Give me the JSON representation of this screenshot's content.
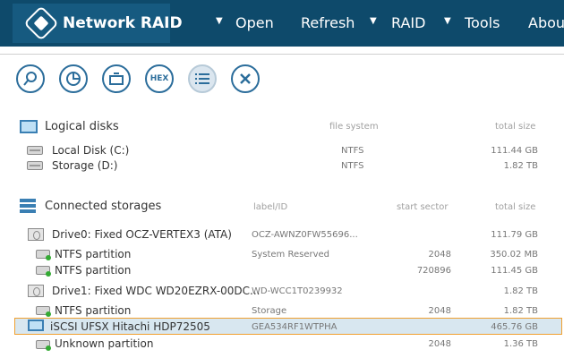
{
  "app": {
    "title": "Network RAID",
    "menu": [
      "Open",
      "Refresh",
      "RAID",
      "Tools",
      "About"
    ],
    "accent": "#0e4a6b"
  },
  "toolbar": {
    "buttons": [
      {
        "name": "search",
        "icon": "magnifier-icon"
      },
      {
        "name": "scan",
        "icon": "pie-chart-icon"
      },
      {
        "name": "image",
        "icon": "disk-image-icon"
      },
      {
        "name": "hex",
        "label": "HEX"
      },
      {
        "name": "list",
        "icon": "list-icon"
      },
      {
        "name": "close",
        "icon": "close-icon"
      }
    ]
  },
  "logical": {
    "title": "Logical disks",
    "col_fs": "file system",
    "col_size": "total size",
    "rows": [
      {
        "name": "Local Disk (C:)",
        "fs": "NTFS",
        "size": "111.44 GB"
      },
      {
        "name": "Storage (D:)",
        "fs": "NTFS",
        "size": "1.82 TB"
      }
    ]
  },
  "storages": {
    "title": "Connected storages",
    "col_label": "label/ID",
    "col_start": "start sector",
    "col_size": "total size",
    "rows": [
      {
        "name": "Drive0: Fixed OCZ-VERTEX3 (ATA)",
        "label": "OCZ-AWNZ0FW55696...",
        "start": "",
        "size": "111.79 GB"
      },
      {
        "name": "NTFS partition",
        "label": "System Reserved",
        "start": "2048",
        "size": "350.02 MB"
      },
      {
        "name": "NTFS partition",
        "label": "",
        "start": "720896",
        "size": "111.45 GB"
      },
      {
        "name": "Drive1: Fixed WDC WD20EZRX-00DC...",
        "label": "WD-WCC1T0239932",
        "start": "",
        "size": "1.82 TB"
      },
      {
        "name": "NTFS partition",
        "label": "Storage",
        "start": "2048",
        "size": "1.82 TB"
      },
      {
        "name": "iSCSI UFSX Hitachi HDP72505",
        "label": "GEA534RF1WTPHA",
        "start": "",
        "size": "465.76 GB"
      },
      {
        "name": "Unknown partition",
        "label": "",
        "start": "2048",
        "size": "1.36 TB"
      }
    ]
  }
}
